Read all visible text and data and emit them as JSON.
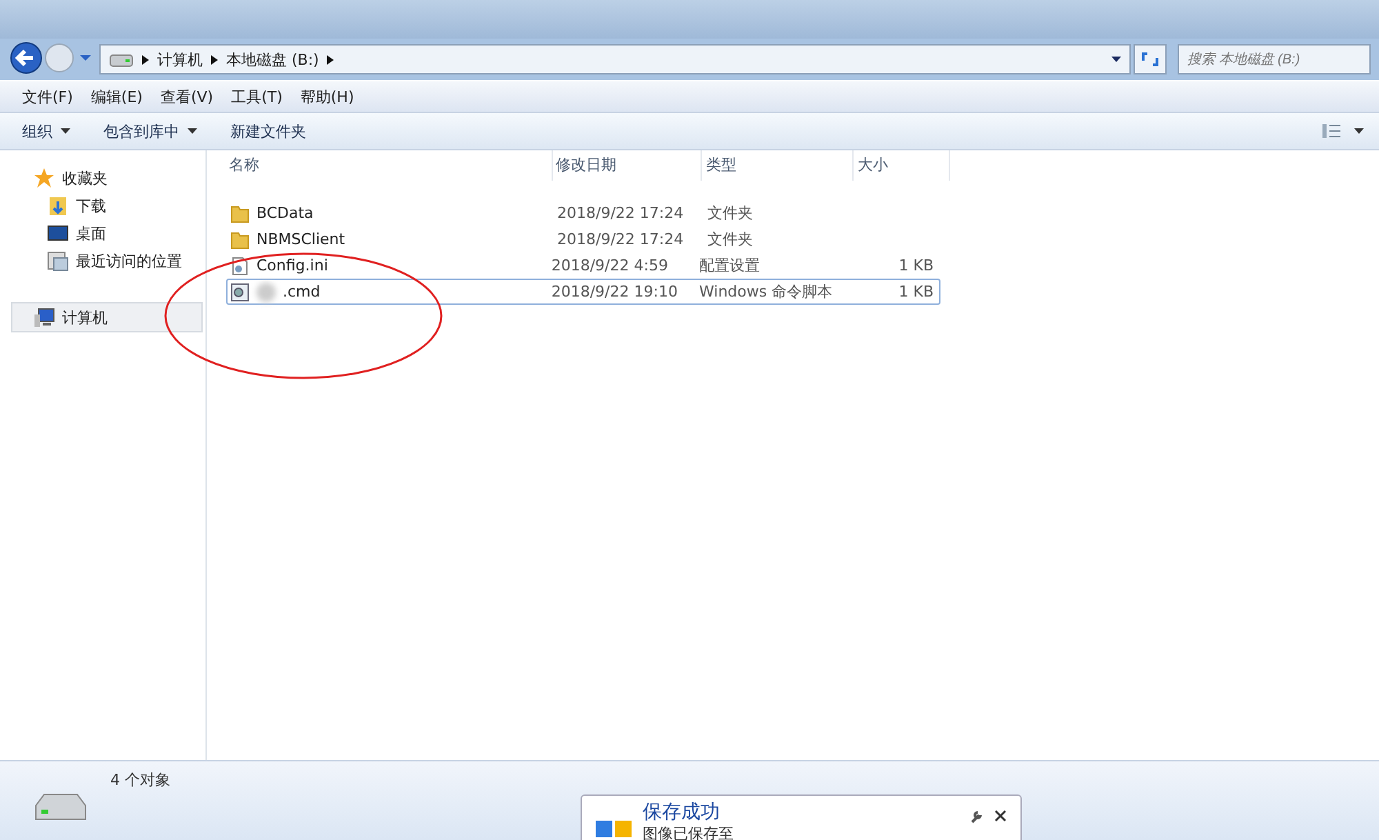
{
  "address": {
    "crumbs": [
      "计算机",
      "本地磁盘 (B:)"
    ]
  },
  "search": {
    "placeholder": "搜索 本地磁盘 (B:)"
  },
  "menu": [
    "文件(F)",
    "编辑(E)",
    "查看(V)",
    "工具(T)",
    "帮助(H)"
  ],
  "toolbar": [
    {
      "label": "组织",
      "dropdown": true
    },
    {
      "label": "包含到库中",
      "dropdown": true
    },
    {
      "label": "新建文件夹",
      "dropdown": false
    }
  ],
  "sidebar": {
    "groups": [
      {
        "label": "收藏夹",
        "kind": "star",
        "selected": false,
        "children": [
          {
            "label": "下载",
            "kind": "download"
          },
          {
            "label": "桌面",
            "kind": "desktop"
          },
          {
            "label": "最近访问的位置",
            "kind": "recent"
          }
        ]
      },
      {
        "label": "计算机",
        "kind": "computer",
        "selected": true
      }
    ]
  },
  "table": {
    "columns": [
      "名称",
      "修改日期",
      "类型",
      "大小"
    ],
    "rows": [
      {
        "name": "BCData",
        "date": "2018/9/22 17:24",
        "type": "文件夹",
        "kind": "folder",
        "selected": false,
        "blurred": false
      },
      {
        "name": "NBMSClient",
        "date": "2018/9/22 17:24",
        "type": "文件夹",
        "kind": "folder",
        "selected": false,
        "blurred": false
      },
      {
        "name": "Config.ini",
        "date": "2018/9/22 4:59",
        "type": "配置设置",
        "size": "1 KB",
        "kind": "ini",
        "selected": false,
        "blurred": false
      },
      {
        "name": ".cmd",
        "date": "2018/9/22 19:10",
        "type": "Windows 命令脚本",
        "size": "1 KB",
        "kind": "cmd",
        "selected": true,
        "blurred": true
      }
    ]
  },
  "status_bar": {
    "count": "4 个对象"
  },
  "toast": {
    "title": "保存成功",
    "message": "图像已保存至"
  }
}
